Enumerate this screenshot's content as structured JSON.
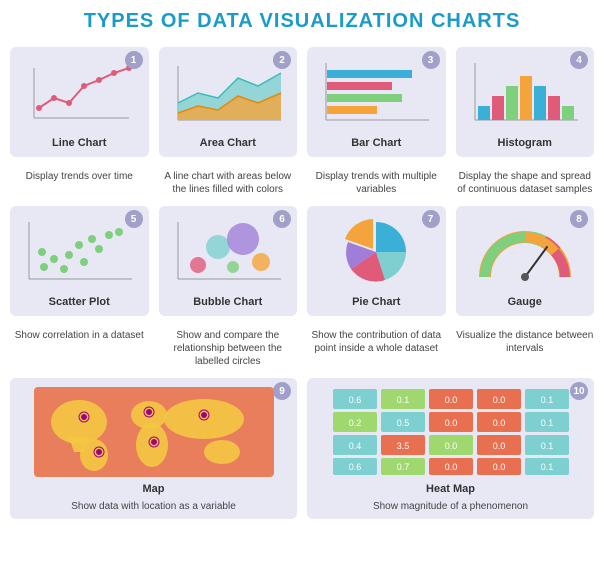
{
  "title": {
    "prefix": "TYPES OF DATA VISUALIZATION ",
    "highlight": "CHARTS"
  },
  "charts": [
    {
      "id": 1,
      "label": "Line Chart",
      "desc": "Display trends over time",
      "badge": "1"
    },
    {
      "id": 2,
      "label": "Area Chart",
      "desc": "A line chart with areas below the lines filled with colors",
      "badge": "2"
    },
    {
      "id": 3,
      "label": "Bar Chart",
      "desc": "Display trends with multiple variables",
      "badge": "3"
    },
    {
      "id": 4,
      "label": "Histogram",
      "desc": "Display the shape and spread of continuous dataset samples",
      "badge": "4"
    },
    {
      "id": 5,
      "label": "Scatter Plot",
      "desc": "Show correlation in a dataset",
      "badge": "5"
    },
    {
      "id": 6,
      "label": "Bubble Chart",
      "desc": "Show and compare the relationship between the labelled circles",
      "badge": "6"
    },
    {
      "id": 7,
      "label": "Pie Chart",
      "desc": "Show the contribution of data point inside a whole dataset",
      "badge": "7"
    },
    {
      "id": 8,
      "label": "Gauge",
      "desc": "Visualize the distance between intervals",
      "badge": "8"
    },
    {
      "id": 9,
      "label": "Map",
      "desc": "Show data with location as a variable",
      "badge": "9"
    },
    {
      "id": 10,
      "label": "Heat Map",
      "desc": "Show magnitude of a phenomenon",
      "badge": "10"
    }
  ]
}
